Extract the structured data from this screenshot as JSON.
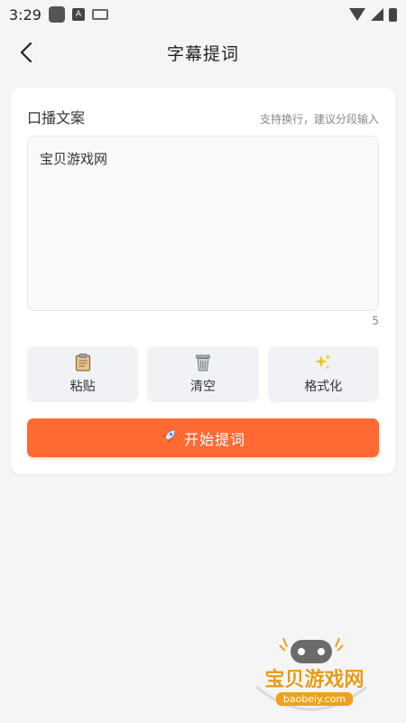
{
  "status_bar": {
    "time": "3:29",
    "a_badge": "A"
  },
  "header": {
    "title": "字幕提词",
    "back_icon": "chevron-left-icon"
  },
  "card": {
    "title": "口播文案",
    "hint": "支持换行，建议分段输入",
    "text_value": "宝贝游戏网",
    "char_count": "5"
  },
  "actions": [
    {
      "label": "粘贴",
      "icon": "clipboard-icon"
    },
    {
      "label": "清空",
      "icon": "trash-icon"
    },
    {
      "label": "格式化",
      "icon": "sparkles-icon"
    }
  ],
  "start_button": {
    "label": "开始提词",
    "icon": "rocket-icon"
  },
  "watermark": {
    "text": "宝贝游戏网",
    "url": "baobeiy.com"
  },
  "colors": {
    "accent": "#ff6a33",
    "background": "#f5f5f7"
  }
}
